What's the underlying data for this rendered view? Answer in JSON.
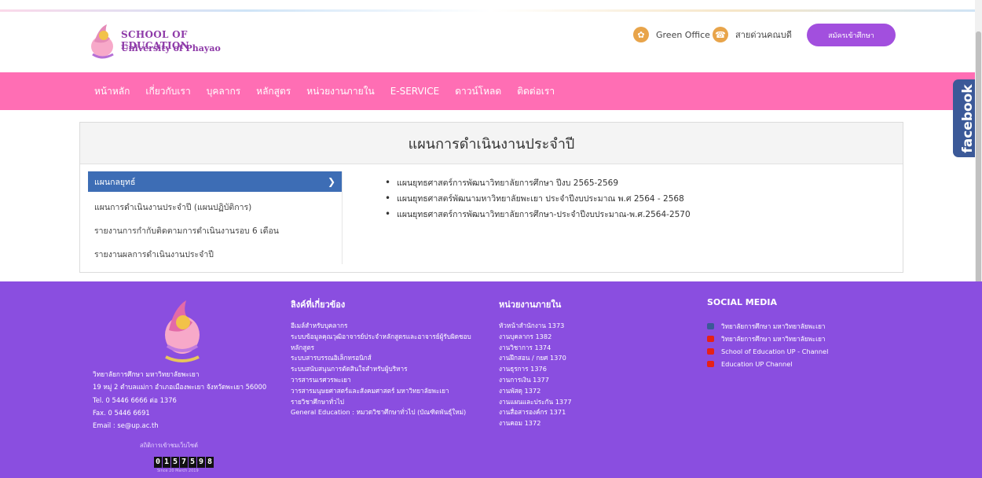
{
  "header": {
    "logo_line1": "SCHOOL OF EDUCATION",
    "logo_line2": "University of Phayao",
    "green_office": "Green Office",
    "hotline": "สายด่วนคณบดี",
    "apply_button": "สมัครเข้าศึกษา"
  },
  "nav": {
    "items": [
      "หน้าหลัก",
      "เกี่ยวกับเรา",
      "บุคลากร",
      "หลักสูตร",
      "หน่วยงานภายใน",
      "E-SERVICE",
      "ดาวน์โหลด",
      "ติดต่อเรา"
    ]
  },
  "facebook_tab": "facebook",
  "main": {
    "title": "แผนการดำเนินงานประจำปี",
    "side_menu": [
      "แผนกลยุทธ์",
      "แผนการดำเนินงานประจำปี (แผนปฏิบัติการ)",
      "รายงานการกำกับติดตามการดำเนินงานรอบ 6 เดือน",
      "รายงานผลการดำเนินงานประจำปี"
    ],
    "documents": [
      "แผนยุทธศาสตร์การพัฒนาวิทยาลัยการศึกษา ปีงบ 2565-2569",
      "แผนยุทธศาสตร์พัฒนามหาวิทยาลัยพะเยา ประจำปีงบประมาณ พ.ศ 2564 - 2568",
      "แผนยุทธศาสตร์การพัฒนาวิทยาลัยการศึกษา-ประจำปีงบประมาณ-พ.ศ.2564-2570"
    ]
  },
  "footer": {
    "address": [
      "วิทยาลัยการศึกษา มหาวิทยาลัยพะเยา",
      "19 หมู่ 2 ตำบลแม่กา อำเภอเมืองพะเยา จังหวัดพะเยา 56000",
      "Tel. 0 5446 6666 ต่อ 1376",
      "Fax. 0 5446 6691",
      "Email : se@up.ac.th"
    ],
    "stats_label": "สถิติการเข้าชมเว็บไซต์",
    "counter": [
      "0",
      "1",
      "5",
      "7",
      "5",
      "9",
      "8"
    ],
    "counter_since": "Since 20 March 2019",
    "links_title": "ลิงค์ที่เกี่ยวข้อง",
    "links": [
      "อีเมล์สำหรับบุคลากร",
      "ระบบข้อมูลคุณวุฒิอาจารย์ประจำหลักสูตรและอาจารย์ผู้รับผิดชอบ",
      "หลักสูตร",
      "ระบบสารบรรณอิเล็กทรอนิกส์",
      "ระบบสนับสนุนการตัดสินใจสำหรับผู้บริหาร",
      "วารสารนเรศวรพะเยา",
      "วารสารมนุษยศาสตร์และสังคมศาสตร์ มหาวิทยาลัยพะเยา",
      "รายวิชาศึกษาทั่วไป",
      "General Education : หมวดวิชาศึกษาทั่วไป (บัณฑิตพันธุ์ใหม่)"
    ],
    "units_title": "หน่วยงานภายใน",
    "units": [
      "หัวหน้าสำนักงาน 1373",
      "งานบุคลากร 1382",
      "งานวิชาการ 1374",
      "งานฝึกสอน / กยศ 1370",
      "งานธุรการ 1376",
      "งานการเงิน 1377",
      "งานพัสดุ 1372",
      "งานแผนและประกัน 1377",
      "งานสื่อสารองค์กร 1371",
      "งานคอม 1372"
    ],
    "social_title": "SOCIAL MEDIA",
    "social": [
      {
        "label": "วิทยาลัยการศึกษา มหาวิทยาลัยพะเยา",
        "icon": "facebook-icon"
      },
      {
        "label": "วิทยาลัยการศึกษา มหาวิทยาลัยพะเยา",
        "icon": "youtube-icon"
      },
      {
        "label": "School of Education UP - Channel",
        "icon": "youtube-icon"
      },
      {
        "label": "Education UP Channel",
        "icon": "youtube-icon"
      }
    ]
  },
  "colors": {
    "nav_bg": "#ff6eb4",
    "footer_bg": "#8a4ee0",
    "active_menu": "#3d6db5",
    "apply_btn": "#a24fde"
  }
}
